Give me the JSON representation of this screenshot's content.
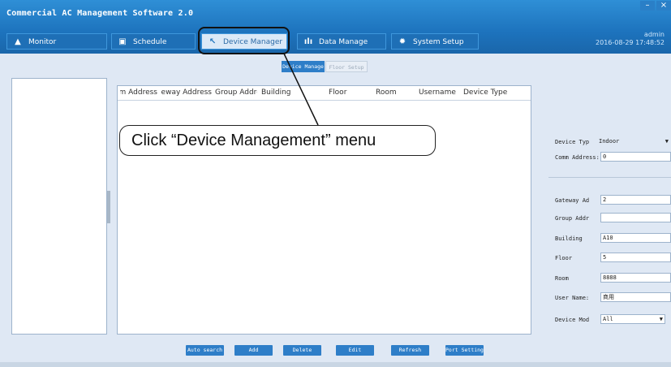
{
  "window": {
    "title": "Commercial AC Management Software 2.0",
    "minimize_glyph": "–",
    "close_glyph": "×",
    "colors": {
      "titlebar": "#1d73bd",
      "button": "#2e7ec8",
      "body": "#dfe8f4"
    }
  },
  "tabs": [
    {
      "label": "Monitor",
      "icon": "person-icon",
      "glyph": "▲"
    },
    {
      "label": "Schedule",
      "icon": "calendar-icon",
      "glyph": "▣"
    },
    {
      "label": "Device Manager",
      "icon": "wrench-icon",
      "glyph": "↖"
    },
    {
      "label": "Data Manage",
      "icon": "bar-chart-icon",
      "glyph": "ılı"
    },
    {
      "label": "System Setup",
      "icon": "gear-icon",
      "glyph": "✹"
    }
  ],
  "user": {
    "name": "admin",
    "datetime": "2016-08-29 17:48:52"
  },
  "subtabs": [
    "Device Manage",
    "Floor Setup"
  ],
  "table": {
    "columns": [
      "Comm Address",
      "Gateway Address",
      "Group Address",
      "Building",
      "Floor",
      "Room",
      "Username",
      "Device Type"
    ]
  },
  "details": {
    "device_type_label": "Device Typ",
    "device_type_value": "Indoor",
    "comm_address_label": "Comm Address:",
    "comm_address_value": "0",
    "gateway_label": "Gateway Ad",
    "gateway_value": "2",
    "group_label": "Group Addr",
    "group_value": "",
    "building_label": "Building",
    "building_value": "A10",
    "floor_label": "Floor",
    "floor_value": "5",
    "room_label": "Room",
    "room_value": "8888",
    "username_label": "User Name:",
    "username_value": "商用",
    "device_mode_label": "Device Mod",
    "device_mode_value": "All"
  },
  "buttons": [
    "Auto search",
    "Add",
    "Delete",
    "Edit",
    "Refresh",
    "Port Setting"
  ],
  "annotation": {
    "text": "Click “Device Management” menu"
  }
}
